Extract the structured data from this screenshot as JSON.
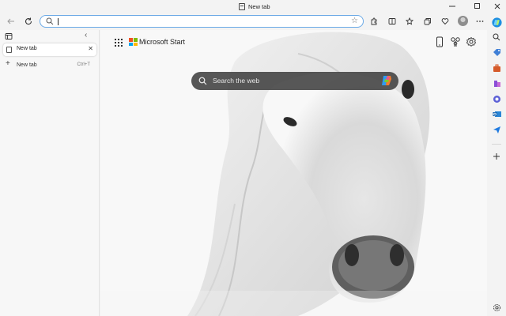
{
  "window": {
    "title": "New tab"
  },
  "toolbar": {
    "address_value": "",
    "address_placeholder": ""
  },
  "tabs_panel": {
    "tabs": [
      {
        "label": "New tab",
        "active": true
      }
    ],
    "new_tab_label": "New tab",
    "new_tab_shortcut": "Ctrl+T"
  },
  "content": {
    "brand": "Microsoft Start",
    "search_placeholder": "Search the web",
    "background": "white horse portrait"
  },
  "colors": {
    "address_border": "#6aa9e6",
    "search_box": "#404040",
    "ms_red": "#f25022",
    "ms_green": "#7fba00",
    "ms_blue": "#00a4ef",
    "ms_yellow": "#ffb900"
  },
  "right_sidebar": {
    "icons": [
      "copilot-icon",
      "search-icon",
      "tag-icon",
      "briefcase-icon",
      "games-icon",
      "microsoft365-icon",
      "outlook-icon",
      "send-icon",
      "add-icon",
      "settings-icon"
    ]
  }
}
